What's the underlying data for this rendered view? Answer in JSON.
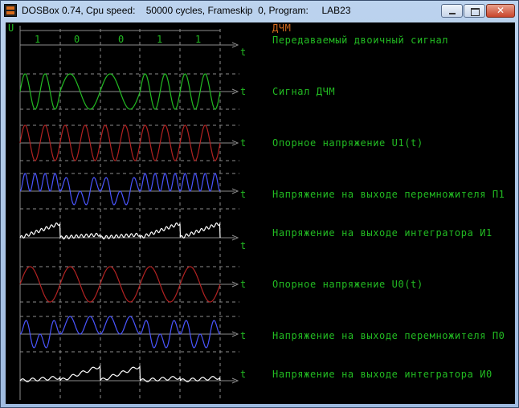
{
  "window": {
    "title": "DOSBox 0.74, Cpu speed:    50000 cycles, Frameskip  0, Program:     LAB23",
    "close_glyph": "✕"
  },
  "colors": {
    "green": "#22bb22",
    "red": "#b22222",
    "blue": "#4a55ff",
    "white": "#ffffff",
    "grey": "#8c8c8c",
    "orange": "#d2691e"
  },
  "screen": {
    "axis_label": "U",
    "time_label": "t",
    "title": "ДЧМ",
    "bits": [
      "1",
      "0",
      "0",
      "1",
      "1"
    ],
    "rows": [
      {
        "id": "binary",
        "label": "Передаваемый двоичный сигнал",
        "color": "green"
      },
      {
        "id": "fsk",
        "label": "Сигнал ДЧМ",
        "color": "green"
      },
      {
        "id": "ref1",
        "label": "Опорное напряжение U1(t)",
        "color": "red"
      },
      {
        "id": "mult1",
        "label": "Напряжение на выходе перемножителя П1",
        "color": "blue"
      },
      {
        "id": "int1",
        "label": "Напряжение на выходе интегратора И1",
        "color": "white"
      },
      {
        "id": "ref0",
        "label": "Опорное напряжение U0(t)",
        "color": "red"
      },
      {
        "id": "mult0",
        "label": "Напряжение на выходе перемножителя П0",
        "color": "blue"
      },
      {
        "id": "int0",
        "label": "Напряжение на выходе интегратора И0",
        "color": "white"
      }
    ]
  }
}
